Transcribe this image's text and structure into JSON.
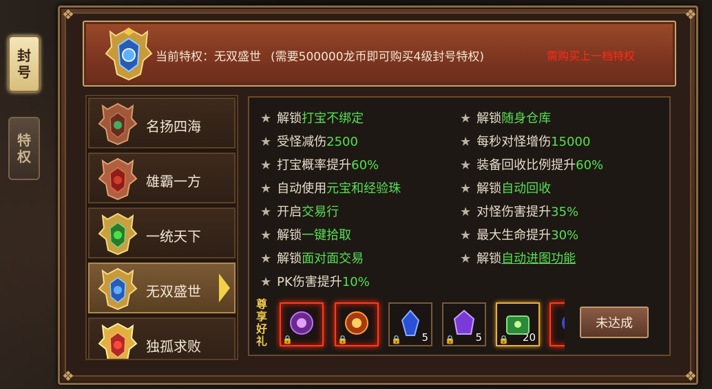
{
  "tabs": [
    {
      "label": "封号",
      "active": true
    },
    {
      "label": "特权",
      "active": false
    }
  ],
  "header": {
    "current_label": "当前特权：无双盛世",
    "requirement": "(需要500000龙币即可购买4级封号特权)",
    "warning": "需购买上一档特权",
    "warning_color": "#ff2a1a"
  },
  "ranks": [
    {
      "name": "名扬四海",
      "icon": "bronze-emblem-icon"
    },
    {
      "name": "雄霸一方",
      "icon": "red-emblem-icon"
    },
    {
      "name": "一统天下",
      "icon": "green-emblem-icon"
    },
    {
      "name": "无双盛世",
      "icon": "blue-emblem-icon",
      "selected": true
    },
    {
      "name": "独孤求败",
      "icon": "gold-emblem-icon"
    }
  ],
  "perks_left": [
    {
      "prefix": "解锁",
      "highlight": "打宝不绑定"
    },
    {
      "prefix": "受怪减伤",
      "highlight": "2500"
    },
    {
      "prefix": "打宝概率提升",
      "highlight": "60%"
    },
    {
      "prefix": "自动使用",
      "highlight": "元宝和经验珠"
    },
    {
      "prefix": "开启",
      "highlight": "交易行"
    },
    {
      "prefix": "解锁",
      "highlight": "一键拾取"
    },
    {
      "prefix": "解锁",
      "highlight": "面对面交易"
    },
    {
      "prefix": "PK伤害提升",
      "highlight": "10%"
    }
  ],
  "perks_right": [
    {
      "prefix": "解锁",
      "highlight": "随身仓库"
    },
    {
      "prefix": "每秒对怪增伤",
      "highlight": "15000"
    },
    {
      "prefix": "装备回收比例提升",
      "highlight": "60%"
    },
    {
      "prefix": "解锁",
      "highlight": "自动回收"
    },
    {
      "prefix": "对怪伤害提升",
      "highlight": "35%"
    },
    {
      "prefix": "最大生命提升",
      "highlight": "30%"
    },
    {
      "prefix": "解锁",
      "highlight": "自动进图功能"
    }
  ],
  "gifts": {
    "label": "尊享好礼",
    "items": [
      {
        "icon": "purple-orb-icon",
        "qty": ""
      },
      {
        "icon": "fire-orb-icon",
        "qty": ""
      },
      {
        "icon": "blue-gem-icon",
        "qty": "5"
      },
      {
        "icon": "purple-gem-icon",
        "qty": "5"
      },
      {
        "icon": "green-chest-icon",
        "qty": "20"
      },
      {
        "icon": "partial-item-icon",
        "qty": ""
      }
    ]
  },
  "button": {
    "label": "未达成"
  }
}
